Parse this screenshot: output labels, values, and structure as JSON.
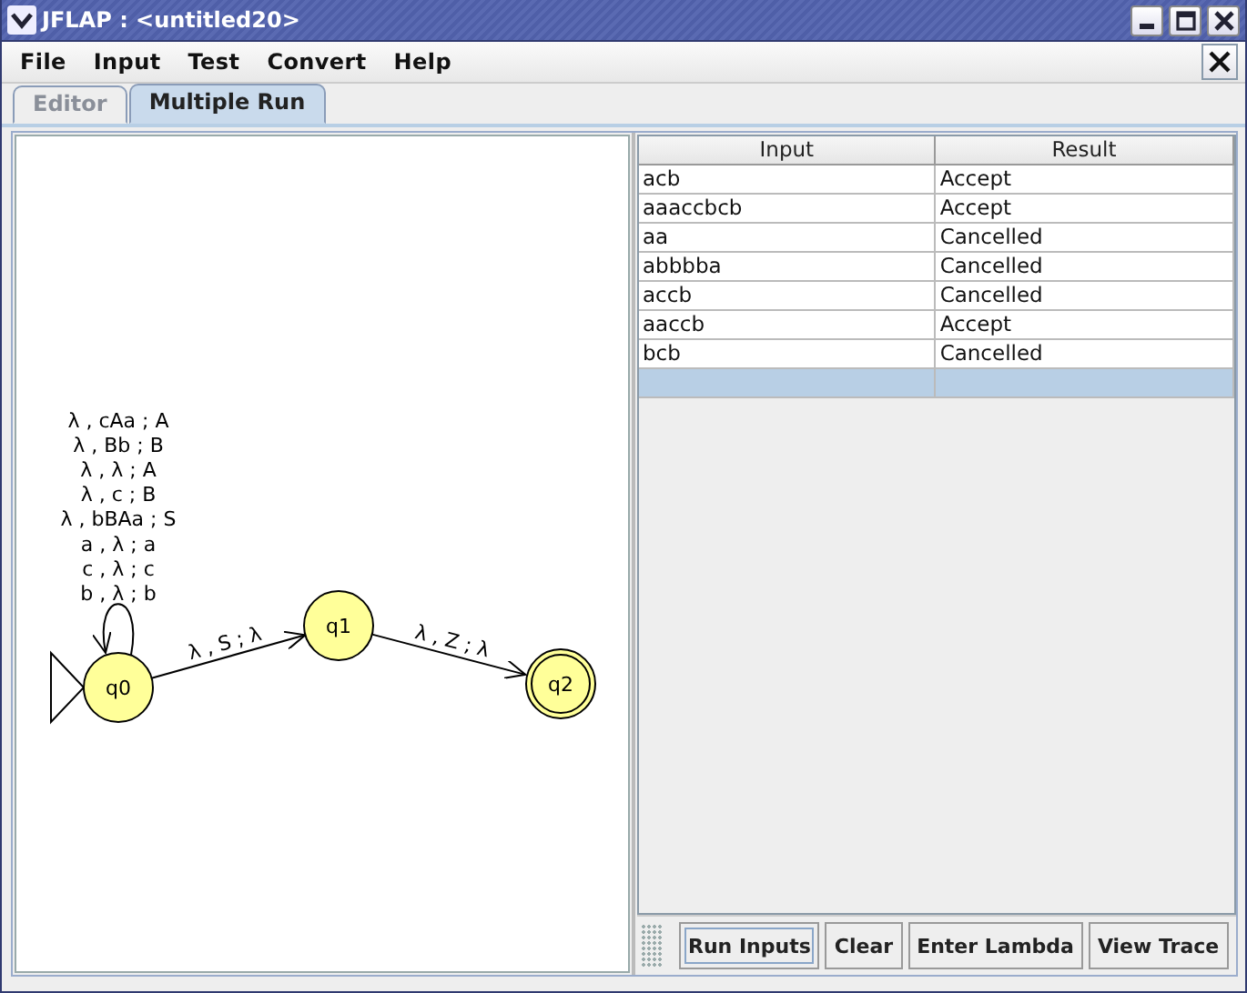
{
  "window": {
    "title": "JFLAP : <untitled20>"
  },
  "menus": [
    "File",
    "Input",
    "Test",
    "Convert",
    "Help"
  ],
  "tabs": [
    {
      "label": "Editor",
      "selected": false,
      "disabled": true
    },
    {
      "label": "Multiple Run",
      "selected": true,
      "disabled": false
    }
  ],
  "automaton": {
    "states": [
      {
        "name": "q0",
        "initial": true,
        "final": false
      },
      {
        "name": "q1",
        "initial": false,
        "final": false
      },
      {
        "name": "q2",
        "initial": false,
        "final": true
      }
    ],
    "transitions": [
      {
        "labels": [
          "λ , cAa ; A",
          "λ , Bb ; B",
          "λ , λ ; A",
          "λ , c ; B",
          "λ , bBAa ; S",
          "a , λ ; a",
          "c , λ ; c",
          "b , λ ; b"
        ]
      },
      {
        "labels": [
          "λ , S ; λ"
        ]
      },
      {
        "labels": [
          "λ , Z ; λ"
        ]
      }
    ]
  },
  "table": {
    "columns": [
      "Input",
      "Result"
    ],
    "rows": [
      {
        "cells": [
          "acb",
          "Accept"
        ],
        "selected": false
      },
      {
        "cells": [
          "aaaccbcb",
          "Accept"
        ],
        "selected": false
      },
      {
        "cells": [
          "aa",
          "Cancelled"
        ],
        "selected": false
      },
      {
        "cells": [
          "abbbba",
          "Cancelled"
        ],
        "selected": false
      },
      {
        "cells": [
          "accb",
          "Cancelled"
        ],
        "selected": false
      },
      {
        "cells": [
          "aaccb",
          "Accept"
        ],
        "selected": false
      },
      {
        "cells": [
          "bcb",
          "Cancelled"
        ],
        "selected": false
      },
      {
        "cells": [],
        "selected": true
      }
    ]
  },
  "buttons": [
    {
      "label": "Run Inputs",
      "focused": true
    },
    {
      "label": "Clear",
      "focused": false
    },
    {
      "label": "Enter Lambda",
      "focused": false
    },
    {
      "label": "View Trace",
      "focused": false
    }
  ]
}
